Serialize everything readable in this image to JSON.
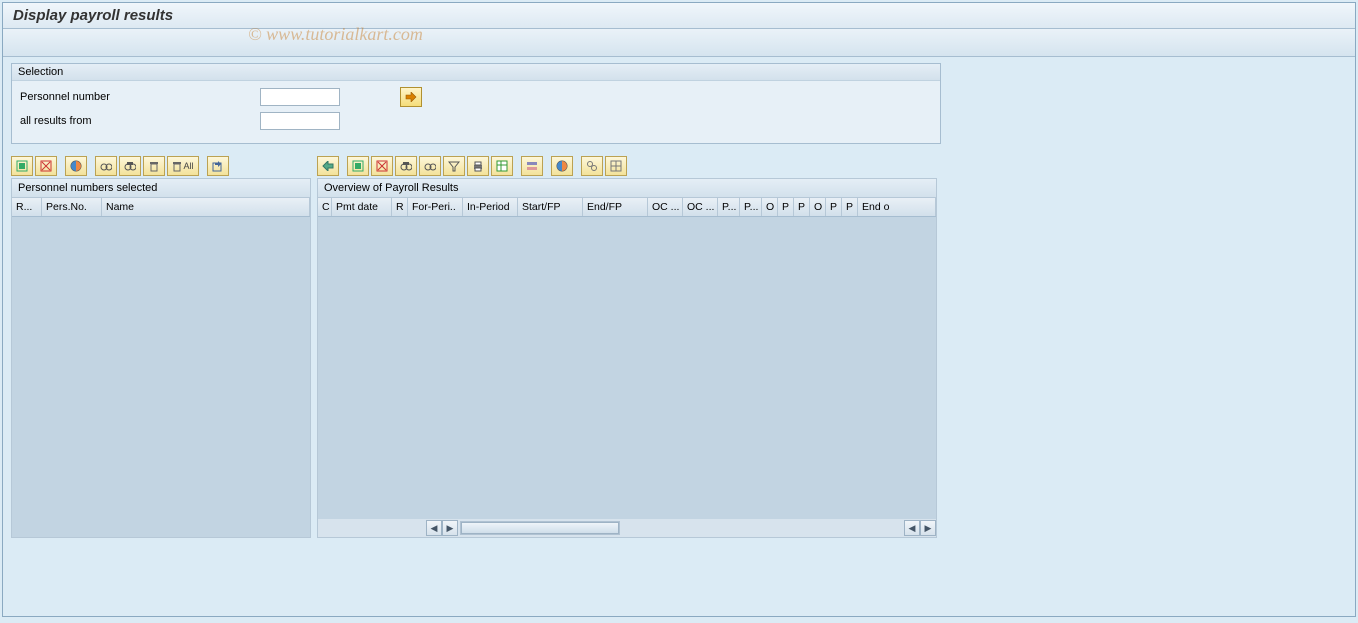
{
  "title": "Display payroll results",
  "watermark": "© www.tutorialkart.com",
  "selection": {
    "title": "Selection",
    "personnel_number_label": "Personnel number",
    "personnel_number_value": "",
    "all_results_from_label": "all results from",
    "all_results_from_value": ""
  },
  "left_panel": {
    "title": "Personnel numbers selected",
    "columns": [
      "R...",
      "Pers.No.",
      "Name"
    ],
    "toolbar_icons": [
      "select-all",
      "deselect-all",
      "variant",
      "find-next",
      "find",
      "delete",
      "delete-all",
      "export"
    ],
    "delete_all_label": "All"
  },
  "right_panel": {
    "title": "Overview of Payroll Results",
    "columns": [
      "C",
      "Pmt date",
      "R",
      "For-Peri..",
      "In-Period",
      "Start/FP",
      "End/FP",
      "OC ...",
      "OC ...",
      "P...",
      "P...",
      "O",
      "P",
      "P",
      "O",
      "P",
      "P",
      "End o"
    ],
    "toolbar_icons": [
      "back",
      "",
      "select-all",
      "deselect-all",
      "find",
      "find-next",
      "filter",
      "print",
      "export",
      "",
      "layout",
      "",
      "variant",
      "",
      "link",
      "grid"
    ]
  }
}
